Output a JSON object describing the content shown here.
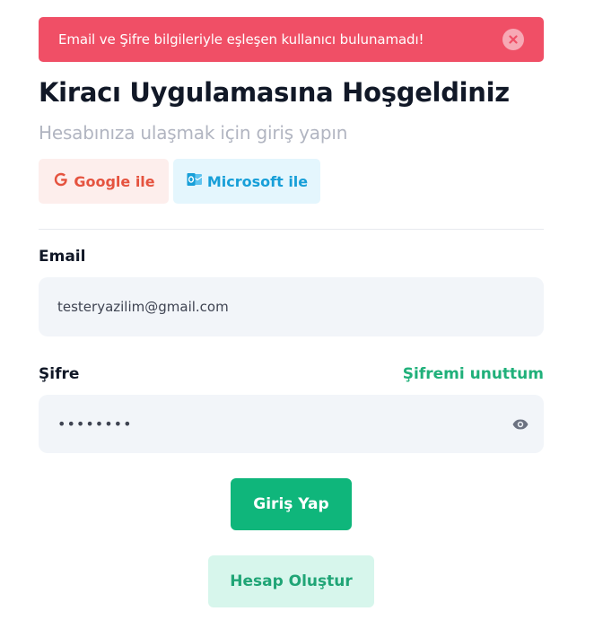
{
  "alert": {
    "message": "Email ve Şifre bilgileriyle eşleşen kullanıcı bulunamadı!"
  },
  "header": {
    "title": "Kiracı Uygulamasına Hoşgeldiniz",
    "subtitle": "Hesabınıza ulaşmak için giriş yapın"
  },
  "social": {
    "google_label": "Google ile",
    "microsoft_label": "Microsoft ile"
  },
  "form": {
    "email_label": "Email",
    "email_value": "testeryazilim@gmail.com",
    "password_label": "Şifre",
    "forgot_label": "Şifremi unuttum",
    "password_mask": "••••••••"
  },
  "buttons": {
    "login_label": "Giriş Yap",
    "register_label": "Hesap Oluştur"
  },
  "colors": {
    "alert_bg": "#f04f66",
    "primary": "#0fb67b",
    "google": "#e5533f",
    "microsoft": "#179fd8"
  },
  "icons": [
    "close-icon",
    "google-icon",
    "microsoft-outlook-icon",
    "eye-icon"
  ]
}
